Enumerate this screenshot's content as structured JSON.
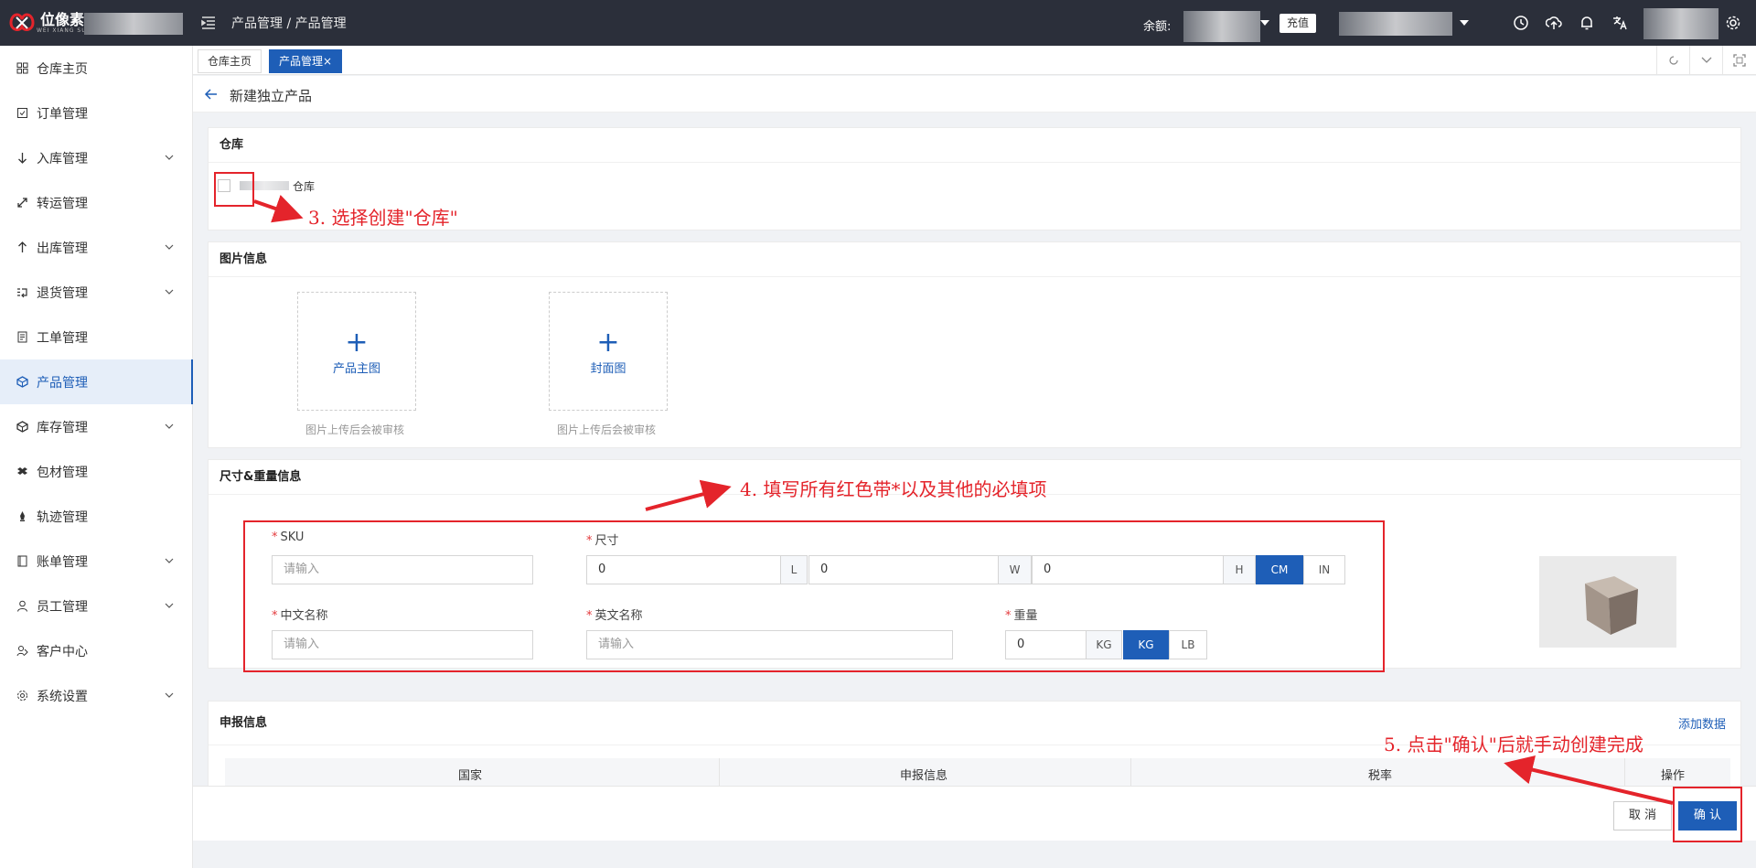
{
  "app": {
    "logo_cn": "位像素",
    "logo_en": "WEI XIANG SU",
    "breadcrumb": "产品管理 / 产品管理",
    "balance_label": "余额:",
    "recharge_label": "充值"
  },
  "sidebar": {
    "items": [
      {
        "label": "仓库主页",
        "icon": "warehouse-icon"
      },
      {
        "label": "订单管理",
        "icon": "order-icon"
      },
      {
        "label": "入库管理",
        "icon": "inbound-icon"
      },
      {
        "label": "转运管理",
        "icon": "transfer-icon"
      },
      {
        "label": "出库管理",
        "icon": "outbound-icon"
      },
      {
        "label": "退货管理",
        "icon": "return-icon"
      },
      {
        "label": "工单管理",
        "icon": "ticket-icon"
      },
      {
        "label": "产品管理",
        "icon": "product-icon"
      },
      {
        "label": "库存管理",
        "icon": "inventory-icon"
      },
      {
        "label": "包材管理",
        "icon": "packaging-icon"
      },
      {
        "label": "轨迹管理",
        "icon": "track-icon"
      },
      {
        "label": "账单管理",
        "icon": "bill-icon"
      },
      {
        "label": "员工管理",
        "icon": "staff-icon"
      },
      {
        "label": "客户中心",
        "icon": "customer-icon"
      },
      {
        "label": "系统设置",
        "icon": "settings-icon"
      }
    ]
  },
  "tabs": [
    {
      "label": "仓库主页"
    },
    {
      "label": "产品管理",
      "close": "×"
    }
  ],
  "page": {
    "title": "新建独立产品"
  },
  "warehouse": {
    "header": "仓库",
    "option_label": "仓库"
  },
  "images": {
    "header": "图片信息",
    "main_label": "产品主图",
    "cover_label": "封面图",
    "plus": "+",
    "note": "图片上传后会被审核"
  },
  "dimensions": {
    "header": "尺寸&重量信息",
    "required_mark": "*",
    "sku_label": "SKU",
    "size_label": "尺寸",
    "cn_name_label": "中文名称",
    "en_name_label": "英文名称",
    "weight_label": "重量",
    "placeholder": "请输入",
    "length": "0",
    "width": "0",
    "height": "0",
    "l": "L",
    "w": "W",
    "h": "H",
    "unit_cm": "CM",
    "unit_in": "IN",
    "weight_value": "0",
    "weight_addon": "KG",
    "unit_kg": "KG",
    "unit_lb": "LB"
  },
  "declaration": {
    "header": "申报信息",
    "add_link": "添加数据",
    "columns": [
      "国家",
      "申报信息",
      "税率",
      "操作"
    ]
  },
  "footer": {
    "cancel": "取 消",
    "confirm": "确 认"
  },
  "annotations": {
    "step3": "3. 选择创建\"仓库\"",
    "step4": "4. 填写所有红色带*以及其他的必填项",
    "step5": "5. 点击\"确认\"后就手动创建完成",
    "color": "#e4242b"
  },
  "colors": {
    "primary": "#1e5eb7",
    "topbar": "#2b2f3a",
    "required": "#e4393c"
  }
}
